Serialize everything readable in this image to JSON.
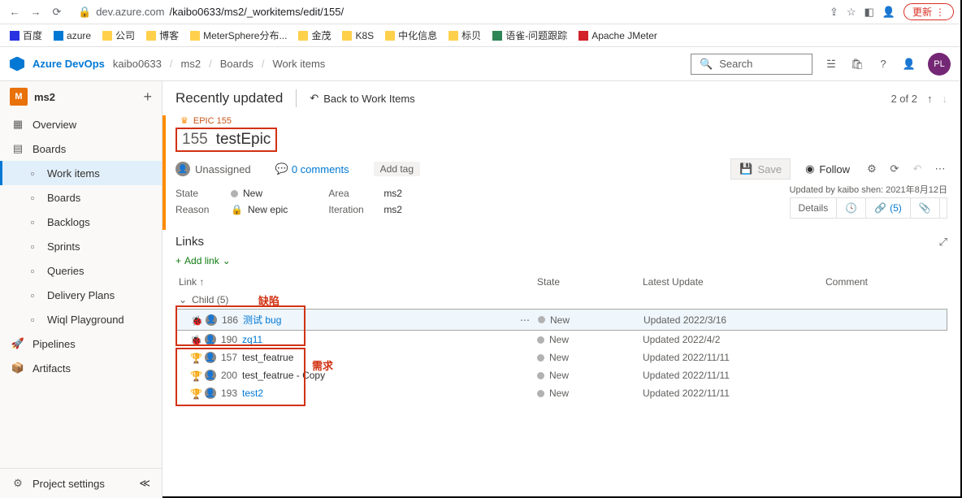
{
  "browser": {
    "url_host": "dev.azure.com",
    "url_path": "/kaibo0633/ms2/_workitems/edit/155/",
    "update_label": "更新"
  },
  "bookmarks": [
    {
      "label": "百度",
      "color": "#2932e1"
    },
    {
      "label": "azure",
      "color": "#0078d4"
    },
    {
      "label": "公司",
      "folder": true
    },
    {
      "label": "博客",
      "folder": true
    },
    {
      "label": "MeterSphere分布...",
      "folder": true
    },
    {
      "label": "金茂",
      "folder": true
    },
    {
      "label": "K8S",
      "folder": true
    },
    {
      "label": "中化信息",
      "folder": true
    },
    {
      "label": "标贝",
      "folder": true
    },
    {
      "label": "语雀-问题跟踪",
      "color": "#2e8555"
    },
    {
      "label": "Apache JMeter",
      "color": "#d22128"
    }
  ],
  "azure": {
    "product": "Azure DevOps",
    "org": "kaibo0633",
    "project": "ms2",
    "section": "Boards",
    "page": "Work items",
    "search_placeholder": "Search",
    "avatar": "PL"
  },
  "sidebar": {
    "project_badge": "M",
    "project_name": "ms2",
    "items": [
      {
        "label": "Overview",
        "icon": "grid"
      },
      {
        "label": "Boards",
        "icon": "board",
        "expanded": true
      },
      {
        "label": "Work items",
        "sub": true,
        "active": true
      },
      {
        "label": "Boards",
        "sub": true
      },
      {
        "label": "Backlogs",
        "sub": true
      },
      {
        "label": "Sprints",
        "sub": true
      },
      {
        "label": "Queries",
        "sub": true
      },
      {
        "label": "Delivery Plans",
        "sub": true
      },
      {
        "label": "Wiql Playground",
        "sub": true
      },
      {
        "label": "Pipelines",
        "icon": "rocket"
      },
      {
        "label": "Artifacts",
        "icon": "artifact"
      }
    ],
    "settings_label": "Project settings"
  },
  "header": {
    "recently": "Recently updated",
    "back": "Back to Work Items",
    "counter": "2 of 2"
  },
  "workitem": {
    "type": "EPIC 155",
    "id": "155",
    "title": "testEpic",
    "assignee": "Unassigned",
    "comments": "0 comments",
    "add_tag": "Add tag",
    "save": "Save",
    "follow": "Follow",
    "fields": {
      "state_label": "State",
      "state_value": "New",
      "reason_label": "Reason",
      "reason_value": "New epic",
      "area_label": "Area",
      "area_value": "ms2",
      "iteration_label": "Iteration",
      "iteration_value": "ms2"
    },
    "updated_by": "Updated by kaibo shen: 2021年8月12日",
    "tabs": {
      "details": "Details",
      "links": "(5)"
    }
  },
  "links": {
    "title": "Links",
    "add_link": "Add link",
    "cols": {
      "link": "Link",
      "state": "State",
      "updated": "Latest Update",
      "comment": "Comment"
    },
    "child_header": "Child (5)",
    "rows": [
      {
        "type": "bug",
        "id": "186",
        "title": "测试 bug",
        "link": true,
        "state": "New",
        "updated": "Updated 2022/3/16",
        "selected": true
      },
      {
        "type": "bug",
        "id": "190",
        "title": "zq11",
        "link": true,
        "state": "New",
        "updated": "Updated 2022/4/2"
      },
      {
        "type": "feature",
        "id": "157",
        "title": "test_featrue",
        "link": false,
        "state": "New",
        "updated": "Updated 2022/11/11"
      },
      {
        "type": "feature",
        "id": "200",
        "title": "test_featrue - Copy",
        "link": false,
        "state": "New",
        "updated": "Updated 2022/11/11"
      },
      {
        "type": "feature",
        "id": "193",
        "title": "test2",
        "link": true,
        "state": "New",
        "updated": "Updated 2022/11/11"
      }
    ]
  },
  "annotations": {
    "bugs": "缺陷",
    "features": "需求"
  }
}
